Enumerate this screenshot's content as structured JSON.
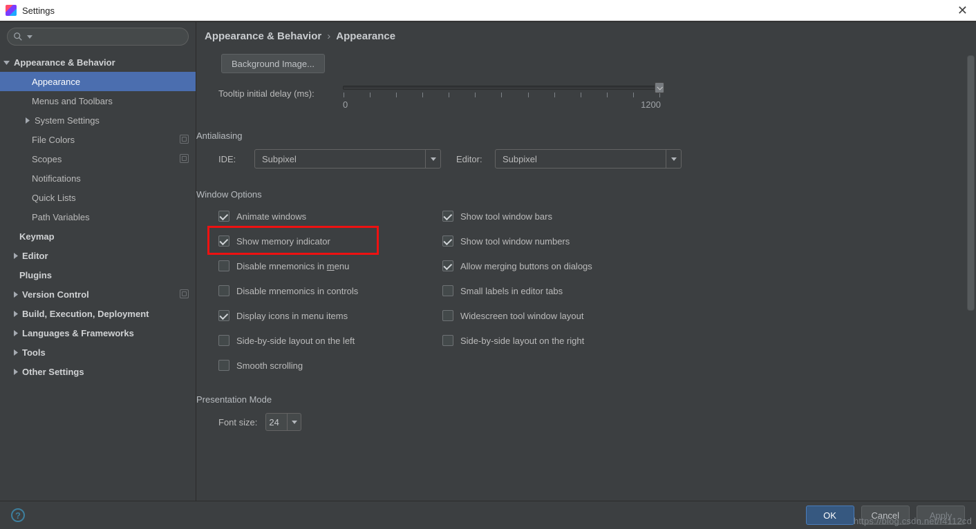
{
  "window": {
    "title": "Settings"
  },
  "search": {
    "placeholder": ""
  },
  "sidebar": [
    {
      "label": "Appearance & Behavior",
      "indent": 16,
      "bold": true,
      "arrow": "down"
    },
    {
      "label": "Appearance",
      "indent": 46,
      "selected": true
    },
    {
      "label": "Menus and Toolbars",
      "indent": 46
    },
    {
      "label": "System Settings",
      "indent": 46,
      "arrow": "right"
    },
    {
      "label": "File Colors",
      "indent": 46,
      "badge": true
    },
    {
      "label": "Scopes",
      "indent": 46,
      "badge": true
    },
    {
      "label": "Notifications",
      "indent": 46
    },
    {
      "label": "Quick Lists",
      "indent": 46
    },
    {
      "label": "Path Variables",
      "indent": 46
    },
    {
      "label": "Keymap",
      "indent": 28,
      "bold": true
    },
    {
      "label": "Editor",
      "indent": 28,
      "bold": true,
      "arrow": "right",
      "arrowLeft": 16
    },
    {
      "label": "Plugins",
      "indent": 28,
      "bold": true
    },
    {
      "label": "Version Control",
      "indent": 28,
      "bold": true,
      "arrow": "right",
      "arrowLeft": 16,
      "badge": true
    },
    {
      "label": "Build, Execution, Deployment",
      "indent": 28,
      "bold": true,
      "arrow": "right",
      "arrowLeft": 16
    },
    {
      "label": "Languages & Frameworks",
      "indent": 28,
      "bold": true,
      "arrow": "right",
      "arrowLeft": 16
    },
    {
      "label": "Tools",
      "indent": 28,
      "bold": true,
      "arrow": "right",
      "arrowLeft": 16
    },
    {
      "label": "Other Settings",
      "indent": 28,
      "bold": true,
      "arrow": "right",
      "arrowLeft": 16
    }
  ],
  "breadcrumb": {
    "a": "Appearance & Behavior",
    "b": "Appearance"
  },
  "bgBtn": "Background Image...",
  "tooltip": {
    "label": "Tooltip initial delay (ms):",
    "min": "0",
    "max": "1200"
  },
  "antialias": {
    "title": "Antialiasing",
    "ide_label": "IDE:",
    "ide_value": "Subpixel",
    "editor_label": "Editor:",
    "editor_value": "Subpixel"
  },
  "winopts": {
    "title": "Window Options",
    "left": [
      {
        "txt": "Animate windows",
        "checked": true
      },
      {
        "txt": "Show memory indicator",
        "checked": true,
        "highlight": true
      },
      {
        "txt": "Disable mnemonics in ",
        "u": "m",
        "after": "enu",
        "checked": false
      },
      {
        "txt": "Disable mnemonics in controls",
        "checked": false
      },
      {
        "txt": "Display icons in menu items",
        "checked": true
      },
      {
        "txt": "Side-by-side layout on the left",
        "checked": false
      },
      {
        "txt": "Smooth scrolling",
        "checked": false
      }
    ],
    "right": [
      {
        "txt": "Show tool window bars",
        "checked": true
      },
      {
        "txt": "Show tool window numbers",
        "checked": true
      },
      {
        "txt": "Allow merging buttons on dialogs",
        "checked": true
      },
      {
        "txt": "Small labels in editor tabs",
        "checked": false
      },
      {
        "txt": "Widescreen tool window layout",
        "checked": false
      },
      {
        "txt": "Side-by-side layout on the right",
        "checked": false
      }
    ]
  },
  "presentation": {
    "title": "Presentation Mode",
    "label": "Font size:",
    "value": "24"
  },
  "footer": {
    "ok": "OK",
    "cancel": "Cancel",
    "apply": "Apply"
  },
  "watermark": "https://blog.csdn.net/f4112cd"
}
